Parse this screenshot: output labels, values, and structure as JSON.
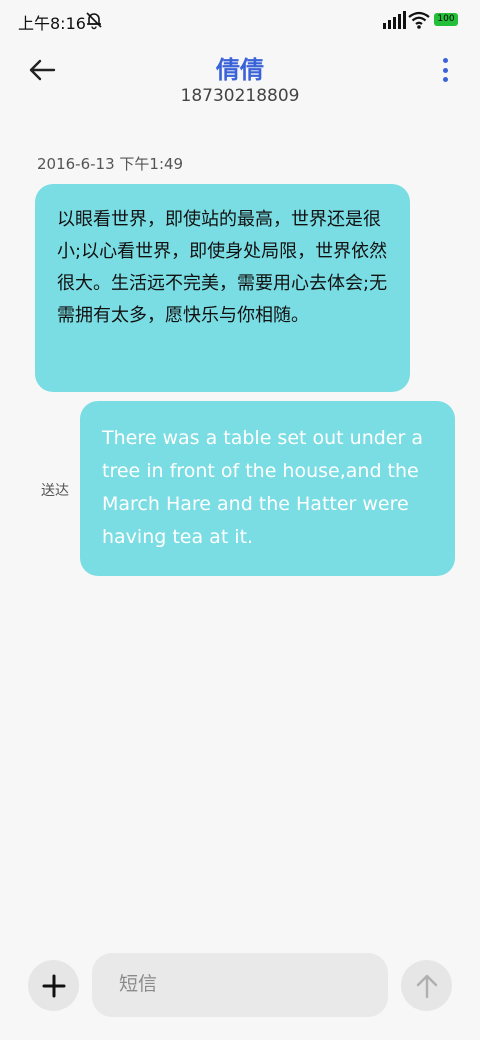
{
  "status_bar": {
    "time": "上午8:16",
    "battery": "100",
    "icons": [
      "mute-bell-icon",
      "signal-icon",
      "wifi-icon",
      "battery-icon"
    ],
    "battery_color": "#22c03a"
  },
  "header": {
    "back_icon": "arrow-left-icon",
    "title": "倩倩",
    "number": "18730218809",
    "more_icon": "more-vertical-icon",
    "accent_color": "#3b63d8"
  },
  "conversation": {
    "timestamp": "2016-6-13 下午1:49",
    "messages": [
      {
        "direction": "incoming",
        "text": "以眼看世界，即使站的最高，世界还是很小;以心看世界，即使身处局限，世界依然很大。生活远不完美，需要用心去体会;无需拥有太多，愿快乐与你相随。"
      },
      {
        "direction": "outgoing",
        "text": "There was a table set out under a tree in front of the house,and the March Hare and the Hatter were having tea at it.",
        "status": "送达"
      }
    ],
    "bubble_color": "#7adde3"
  },
  "composer": {
    "add_icon": "plus-icon",
    "placeholder": "短信",
    "value": "",
    "send_icon": "arrow-up-icon"
  }
}
